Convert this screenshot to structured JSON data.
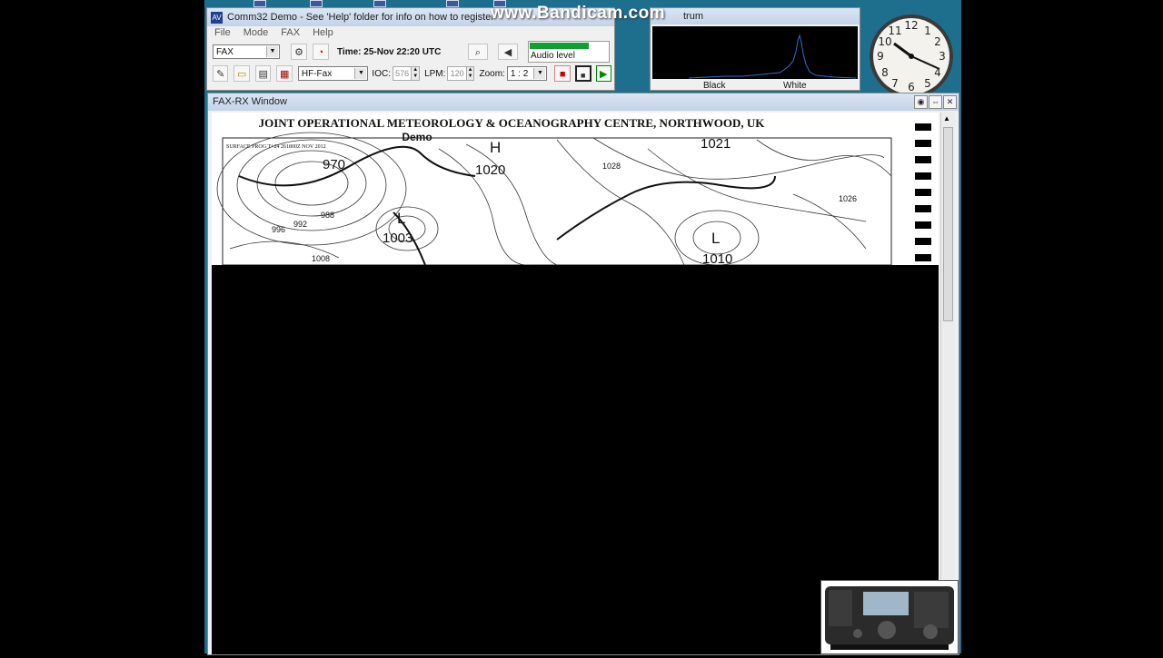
{
  "watermark": "www.Bandicam.com",
  "app": {
    "title": "Comm32 Demo  -  See 'Help' folder for info on how to register",
    "icon_text": "AV",
    "menu": [
      "File",
      "Mode",
      "FAX",
      "Help"
    ],
    "mode_value": "FAX",
    "time_text": "Time: 25-Nov 22:20  UTC",
    "audio_label": "Audio level",
    "audio_level": 0.75,
    "fax_type": "HF-Fax",
    "ioc_label": "IOC:",
    "ioc_value": "576",
    "lpm_label": "LPM:",
    "lpm_value": "120",
    "zoom_label": "Zoom:",
    "zoom_value": "1 : 2"
  },
  "spectrum": {
    "title": "trum",
    "label_black": "Black",
    "label_white": "White"
  },
  "fax": {
    "title": "FAX-RX Window",
    "map_header": "JOINT OPERATIONAL METEOROLOGY & OCEANOGRAPHY CENTRE, NORTHWOOD, UK",
    "demo_text": "Demo",
    "surface_prog": "SURFACE PROG T+24 261800Z NOV 2012",
    "pressure_labels": [
      "970",
      "1020",
      "1021",
      "1003",
      "1010",
      "1008",
      "992",
      "996",
      "988",
      "1028",
      "1026"
    ],
    "pressure_centers": [
      "H",
      "L",
      "L"
    ]
  },
  "colors": {
    "desktop": "#1e6f8e",
    "titlebar": "#c4d3e8",
    "audio_bar": "#10a030"
  },
  "icons": [
    "settings-icon",
    "timer-icon",
    "search-icon",
    "speaker-icon",
    "open-folder-icon",
    "save-icon",
    "clipboard-icon",
    "stop-icon",
    "pause-icon",
    "play-icon",
    "clock-icon",
    "radio-icon"
  ]
}
